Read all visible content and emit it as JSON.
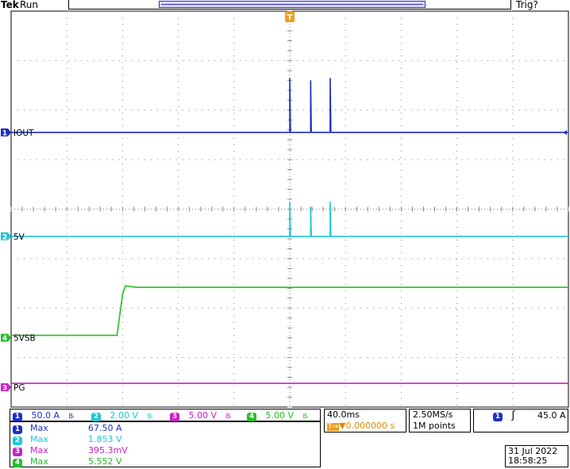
{
  "header": {
    "brand": "Tek",
    "run_state": "Run",
    "trigger_state": "Trig?"
  },
  "trigger_marker": "T",
  "channels": [
    {
      "num": "1",
      "label": "IOUT",
      "color": "#1e2fc8",
      "scale": "50.0 A",
      "bw": "Bₗ"
    },
    {
      "num": "2",
      "label": "5V",
      "color": "#1ec8d8",
      "scale": "2.00 V",
      "bw": "Bₗ"
    },
    {
      "num": "3",
      "label": "PG",
      "color": "#c81ec8",
      "scale": "5.00 V",
      "bw": "Bₗ"
    },
    {
      "num": "4",
      "label": "5VSB",
      "color": "#22c022",
      "scale": "5.00 V",
      "bw": "Bₗ"
    }
  ],
  "timebase": {
    "scale": "40.0ms",
    "delay": "▼0.000000 s",
    "delay_prefix": "T→"
  },
  "acquisition": {
    "rate": "2.50MS/s",
    "points": "1M points"
  },
  "trigger": {
    "source": "1",
    "slope": "ʃ",
    "level": "45.0 A"
  },
  "measurements": [
    {
      "num": "1",
      "type": "Max",
      "value": "67.50 A",
      "color": "#1e2fc8"
    },
    {
      "num": "2",
      "type": "Max",
      "value": "1.853 V",
      "color": "#1ec8d8"
    },
    {
      "num": "3",
      "type": "Max",
      "value": "395.3mV",
      "color": "#c81ec8"
    },
    {
      "num": "4",
      "type": "Max",
      "value": "5.552 V",
      "color": "#22c022"
    }
  ],
  "datetime": {
    "date": "31 Jul  2022",
    "time": "18:58:25"
  },
  "chart_data": {
    "type": "line",
    "title": "",
    "xlabel": "",
    "ylabel": "",
    "x_unit": "ms",
    "time_per_div_ms": 40,
    "xlim": [
      -200,
      200
    ],
    "ylim_div": [
      -4,
      4
    ],
    "grid": true,
    "series": [
      {
        "name": "IOUT",
        "channel": 1,
        "color": "#1e2fc8",
        "offset_div": 1.55,
        "scale_per_div": 50,
        "points": [
          [
            -200,
            0
          ],
          [
            0,
            0
          ],
          [
            0,
            1.1
          ],
          [
            0.5,
            0
          ],
          [
            15,
            0
          ],
          [
            15,
            1.05
          ],
          [
            15.5,
            0
          ],
          [
            29,
            0
          ],
          [
            29,
            1.1
          ],
          [
            29.5,
            0
          ],
          [
            200,
            0
          ]
        ]
      },
      {
        "name": "5V",
        "channel": 2,
        "color": "#1ec8d8",
        "offset_div": -0.55,
        "scale_per_div": 2,
        "points": [
          [
            -200,
            0
          ],
          [
            0,
            0
          ],
          [
            0,
            0.7
          ],
          [
            0.5,
            0
          ],
          [
            15,
            0
          ],
          [
            15,
            0.6
          ],
          [
            15.5,
            0
          ],
          [
            29,
            0
          ],
          [
            29,
            0.7
          ],
          [
            29.5,
            0
          ],
          [
            200,
            0
          ]
        ]
      },
      {
        "name": "5VSB",
        "channel": 4,
        "color": "#22c022",
        "offset_div": -2.6,
        "scale_per_div": 5,
        "points": [
          [
            -200,
            0.05
          ],
          [
            -124,
            0.05
          ],
          [
            -120,
            0.88
          ],
          [
            -118,
            1.05
          ],
          [
            -110,
            1.02
          ],
          [
            0,
            1.02
          ],
          [
            200,
            1.02
          ]
        ]
      },
      {
        "name": "PG",
        "channel": 3,
        "color": "#c81ec8",
        "offset_div": -3.6,
        "scale_per_div": 5,
        "points": [
          [
            -200,
            0.08
          ],
          [
            200,
            0.08
          ]
        ]
      }
    ]
  }
}
